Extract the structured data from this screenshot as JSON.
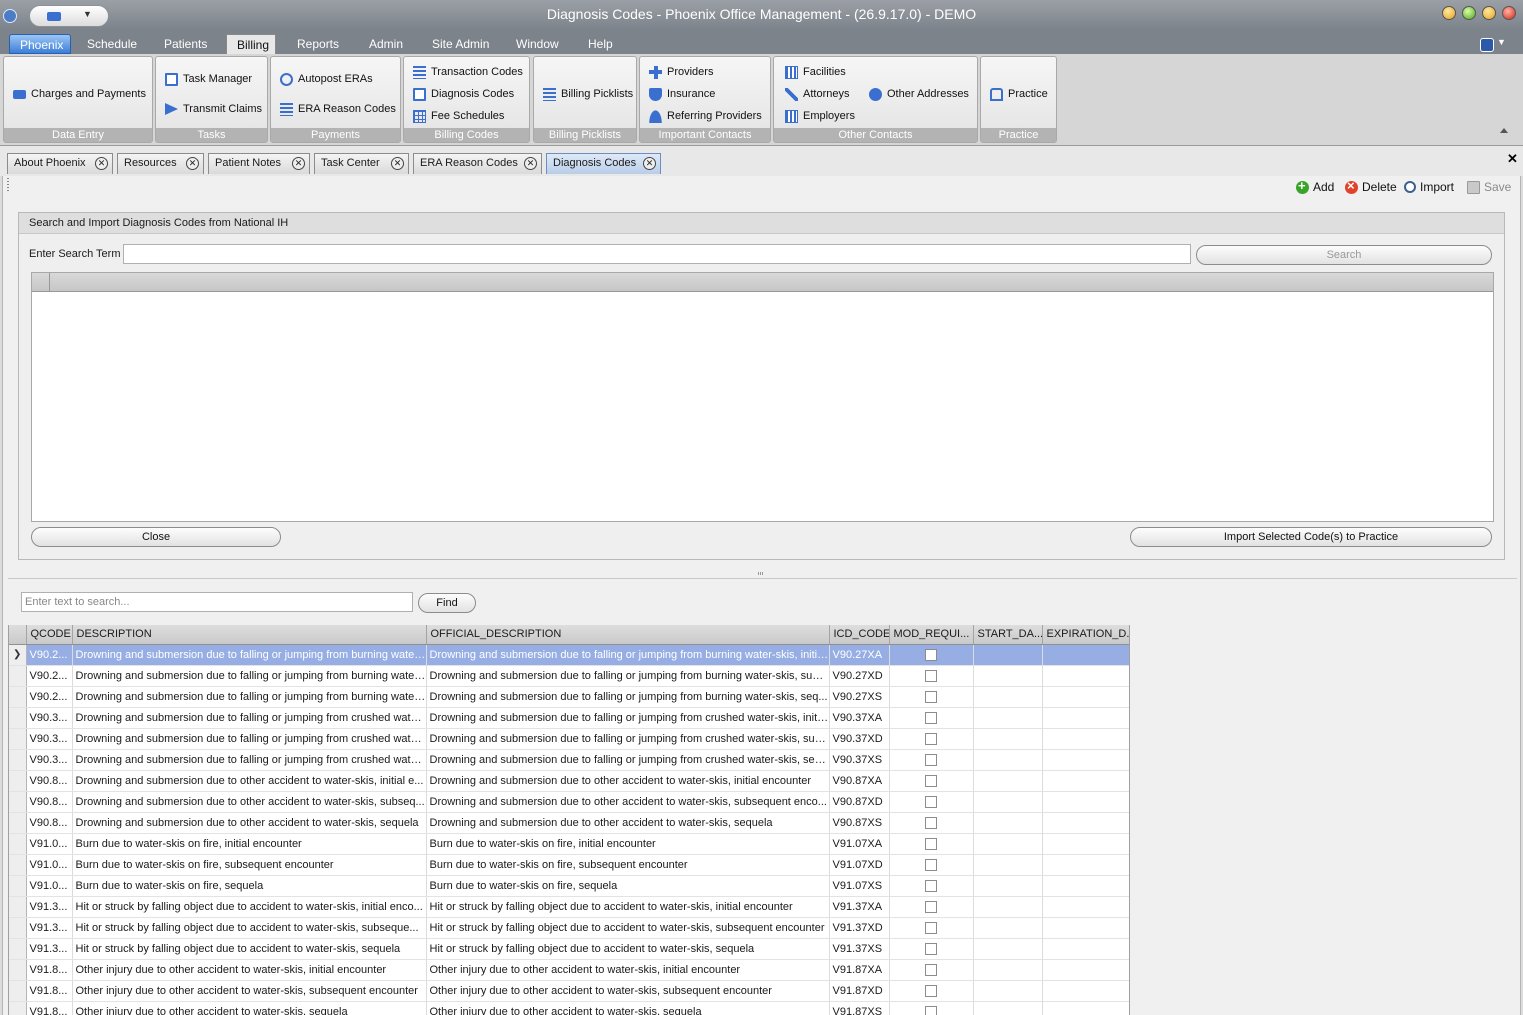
{
  "window": {
    "title": "Diagnosis Codes - Phoenix Office Management - (26.9.17.0) - DEMO"
  },
  "menu": {
    "items": [
      "Phoenix",
      "Schedule",
      "Patients",
      "Billing",
      "Reports",
      "Admin",
      "Site Admin",
      "Window",
      "Help"
    ],
    "active": "Billing"
  },
  "ribbon": {
    "data_entry": {
      "label": "Data Entry",
      "charges_payments": "Charges and Payments"
    },
    "tasks": {
      "label": "Tasks",
      "task_manager": "Task Manager",
      "transmit_claims": "Transmit Claims"
    },
    "payments": {
      "label": "Payments",
      "autopost_eras": "Autopost ERAs",
      "era_reason_codes": "ERA Reason Codes"
    },
    "billing_codes": {
      "label": "Billing Codes",
      "transaction_codes": "Transaction Codes",
      "diagnosis_codes": "Diagnosis Codes",
      "fee_schedules": "Fee Schedules"
    },
    "billing_picklists": {
      "label": "Billing Picklists",
      "billing_picklists": "Billing Picklists"
    },
    "important_contacts": {
      "label": "Important Contacts",
      "providers": "Providers",
      "insurance": "Insurance",
      "referring_providers": "Referring Providers"
    },
    "other_contacts": {
      "label": "Other Contacts",
      "facilities": "Facilities",
      "attorneys": "Attorneys",
      "employers": "Employers",
      "other_addresses": "Other Addresses"
    },
    "practice": {
      "label": "Practice",
      "practice": "Practice"
    }
  },
  "doc_tabs": [
    "About Phoenix",
    "Resources",
    "Patient Notes",
    "Task Center",
    "ERA Reason Codes",
    "Diagnosis Codes"
  ],
  "toolbar": {
    "add": "Add",
    "delete": "Delete",
    "import": "Import",
    "save": "Save"
  },
  "import_panel": {
    "header": "Search and Import Diagnosis Codes from National IH",
    "search_label": "Enter Search Term",
    "search_value": "",
    "search_button": "Search",
    "close_button": "Close",
    "import_button": "Import Selected Code(s) to Practice"
  },
  "find": {
    "placeholder": "Enter text to search...",
    "button": "Find"
  },
  "grid": {
    "columns": [
      "QCODE",
      "DESCRIPTION",
      "OFFICIAL_DESCRIPTION",
      "ICD_CODE",
      "MOD_REQUI...",
      "START_DA...",
      "EXPIRATION_D..."
    ],
    "rows": [
      {
        "qcode": "V90.2...",
        "desc": "Drowning and submersion due to falling or jumping from burning water...",
        "official": "Drowning and submersion due to falling or jumping from burning water-skis, initia...",
        "icd": "V90.27XA"
      },
      {
        "qcode": "V90.2...",
        "desc": "Drowning and submersion due to falling or jumping from burning water...",
        "official": "Drowning and submersion due to falling or jumping from burning water-skis, subs...",
        "icd": "V90.27XD"
      },
      {
        "qcode": "V90.2...",
        "desc": "Drowning and submersion due to falling or jumping from burning water...",
        "official": "Drowning and submersion due to falling or jumping from burning water-skis, seq...",
        "icd": "V90.27XS"
      },
      {
        "qcode": "V90.3...",
        "desc": "Drowning and submersion due to falling or jumping from crushed wate...",
        "official": "Drowning and submersion due to falling or jumping from crushed water-skis, initi...",
        "icd": "V90.37XA"
      },
      {
        "qcode": "V90.3...",
        "desc": "Drowning and submersion due to falling or jumping from crushed wate...",
        "official": "Drowning and submersion due to falling or jumping from crushed water-skis, sub...",
        "icd": "V90.37XD"
      },
      {
        "qcode": "V90.3...",
        "desc": "Drowning and submersion due to falling or jumping from crushed wate...",
        "official": "Drowning and submersion due to falling or jumping from crushed water-skis, seq...",
        "icd": "V90.37XS"
      },
      {
        "qcode": "V90.8...",
        "desc": "Drowning and submersion due to other accident to water-skis, initial e...",
        "official": "Drowning and submersion due to other accident to water-skis, initial encounter",
        "icd": "V90.87XA"
      },
      {
        "qcode": "V90.8...",
        "desc": "Drowning and submersion due to other accident to water-skis, subseq...",
        "official": "Drowning and submersion due to other accident to water-skis, subsequent enco...",
        "icd": "V90.87XD"
      },
      {
        "qcode": "V90.8...",
        "desc": "Drowning and submersion due to other accident to water-skis, sequela",
        "official": "Drowning and submersion due to other accident to water-skis, sequela",
        "icd": "V90.87XS"
      },
      {
        "qcode": "V91.0...",
        "desc": "Burn due to water-skis on fire, initial encounter",
        "official": "Burn due to water-skis on fire, initial encounter",
        "icd": "V91.07XA"
      },
      {
        "qcode": "V91.0...",
        "desc": "Burn due to water-skis on fire, subsequent encounter",
        "official": "Burn due to water-skis on fire, subsequent encounter",
        "icd": "V91.07XD"
      },
      {
        "qcode": "V91.0...",
        "desc": "Burn due to water-skis on fire, sequela",
        "official": "Burn due to water-skis on fire, sequela",
        "icd": "V91.07XS"
      },
      {
        "qcode": "V91.3...",
        "desc": "Hit or struck by falling object due to accident to water-skis, initial enco...",
        "official": "Hit or struck by falling object due to accident to water-skis, initial encounter",
        "icd": "V91.37XA"
      },
      {
        "qcode": "V91.3...",
        "desc": "Hit or struck by falling object due to accident to water-skis, subseque...",
        "official": "Hit or struck by falling object due to accident to water-skis, subsequent encounter",
        "icd": "V91.37XD"
      },
      {
        "qcode": "V91.3...",
        "desc": "Hit or struck by falling object due to accident to water-skis, sequela",
        "official": "Hit or struck by falling object due to accident to water-skis, sequela",
        "icd": "V91.37XS"
      },
      {
        "qcode": "V91.8...",
        "desc": "Other injury due to other accident to water-skis, initial encounter",
        "official": "Other injury due to other accident to water-skis, initial encounter",
        "icd": "V91.87XA"
      },
      {
        "qcode": "V91.8...",
        "desc": "Other injury due to other accident to water-skis, subsequent encounter",
        "official": "Other injury due to other accident to water-skis, subsequent encounter",
        "icd": "V91.87XD"
      },
      {
        "qcode": "V91.8...",
        "desc": "Other injury due to other accident to water-skis, sequela",
        "official": "Other injury due to other accident to water-skis, sequela",
        "icd": "V91.87XS"
      }
    ],
    "selected_row": 0
  },
  "colors": {
    "accent": "#3a6fd0",
    "selection": "#96aee3",
    "titlebar": "#7d838a"
  }
}
